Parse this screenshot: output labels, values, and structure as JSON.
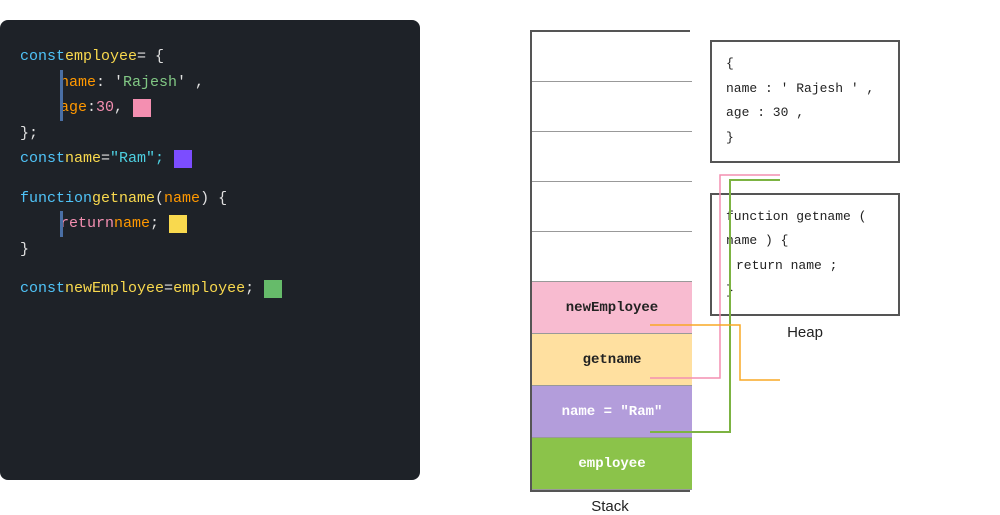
{
  "code": {
    "line1": "const ",
    "line1b": "employee",
    "line1c": " = {",
    "line2a": "name",
    "line2b": " : ' ",
    "line2c": "Rajesh",
    "line2d": " ' ,",
    "line3a": "age",
    "line3b": " : ",
    "line3c": "30",
    "line3d": " ,",
    "line4": "};",
    "line5a": "const ",
    "line5b": "name",
    "line5c": " = \"Ram\";",
    "line6a": "function ",
    "line6b": "getname",
    "line6c": " ( ",
    "line6d": "name",
    "line6e": " ) {",
    "line7a": "return ",
    "line7b": "name",
    "line7c": " ;",
    "line8": "}",
    "line9a": "const ",
    "line9b": "newEmployee",
    "line9c": " = ",
    "line9d": "employee",
    "line9e": " ;"
  },
  "stack": {
    "label": "Stack",
    "cells": [
      "",
      "",
      "",
      "",
      ""
    ],
    "named": [
      {
        "text": "newEmployee",
        "class": "cell-newemployee"
      },
      {
        "text": "getname",
        "class": "cell-getname"
      },
      {
        "text": "name = \"Ram\"",
        "class": "cell-name"
      },
      {
        "text": "employee",
        "class": "cell-employee"
      }
    ]
  },
  "heap": {
    "label": "Heap",
    "box1": {
      "line1": "{",
      "line2": "  name : ' Rajesh ' ,",
      "line3": "  age : 30 ,",
      "line4": "}"
    },
    "box2": {
      "line1": "function getname ( name ) {",
      "line2": "  return name ;",
      "line3": "}"
    }
  }
}
